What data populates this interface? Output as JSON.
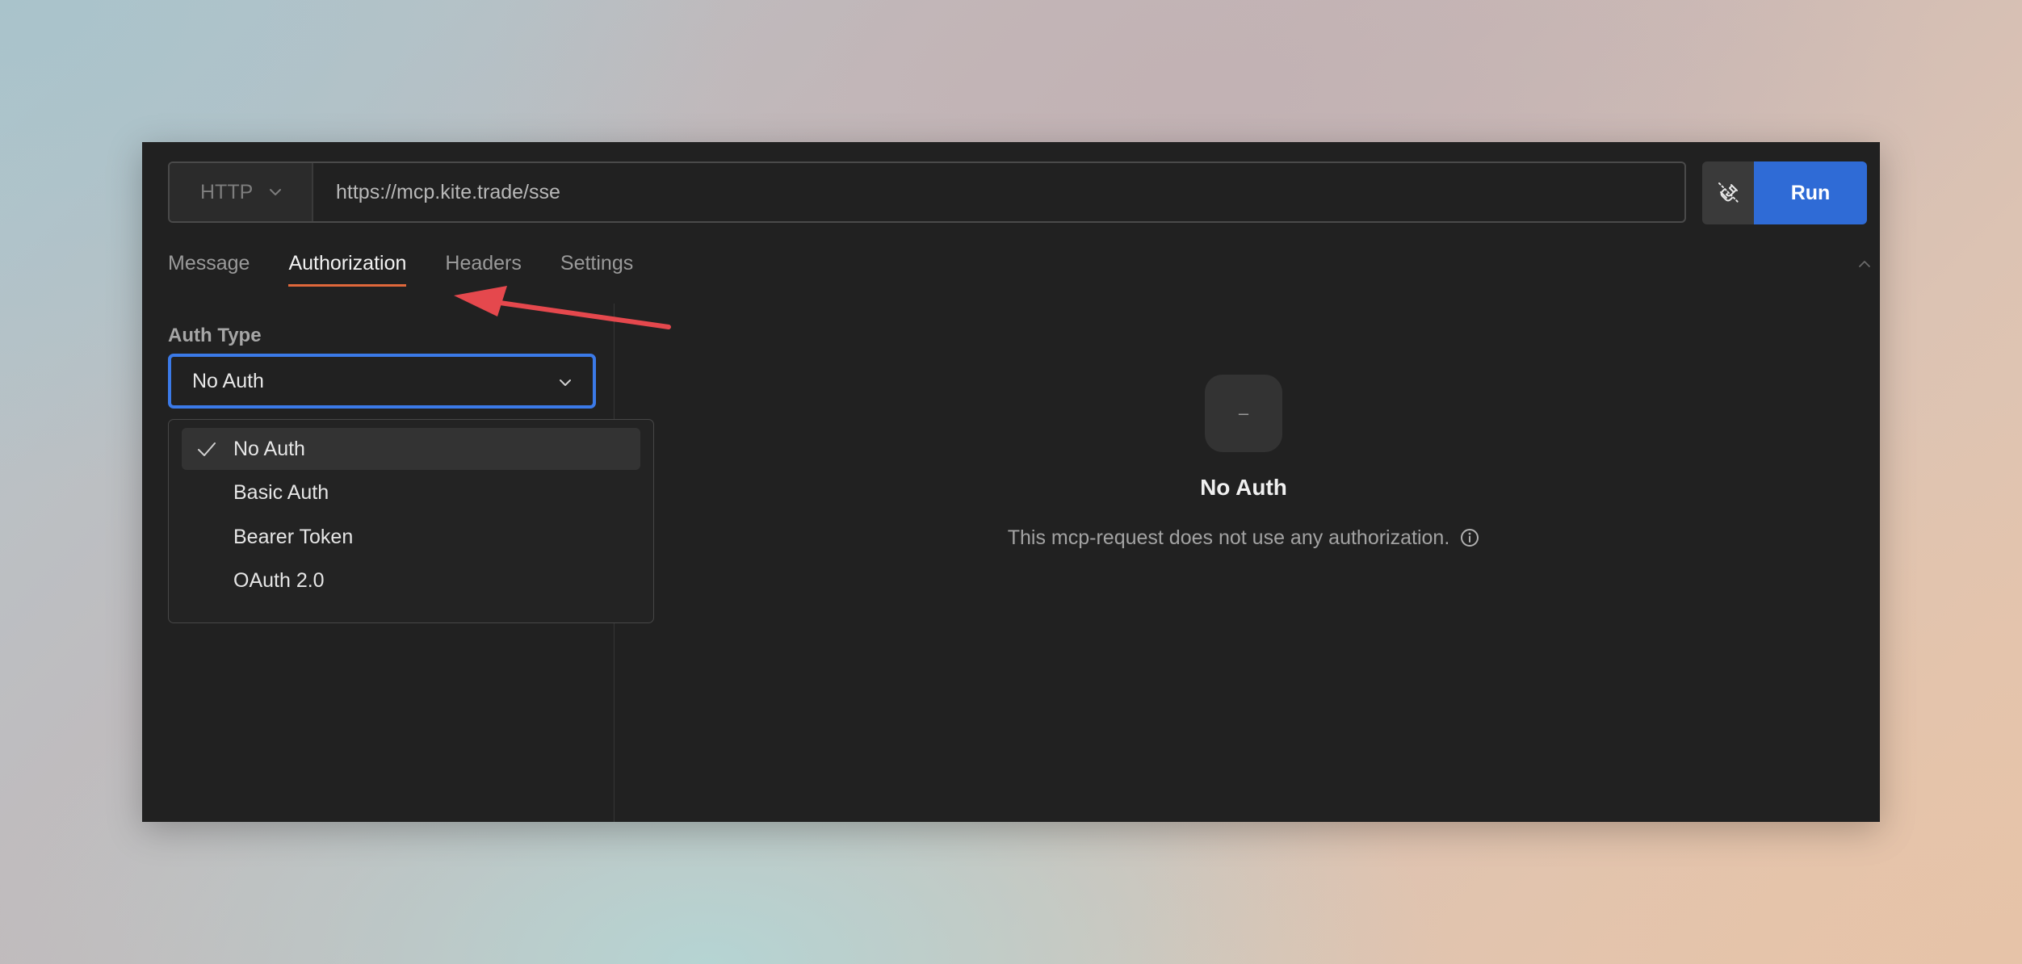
{
  "request": {
    "method": "HTTP",
    "url": "https://mcp.kite.trade/sse",
    "run_label": "Run"
  },
  "tabs": [
    {
      "label": "Message"
    },
    {
      "label": "Authorization"
    },
    {
      "label": "Headers"
    },
    {
      "label": "Settings"
    }
  ],
  "active_tab": "Authorization",
  "auth": {
    "label": "Auth Type",
    "selected": "No Auth",
    "options": [
      {
        "label": "No Auth",
        "selected": true
      },
      {
        "label": "Basic Auth",
        "selected": false
      },
      {
        "label": "Bearer Token",
        "selected": false
      },
      {
        "label": "OAuth 2.0",
        "selected": false
      }
    ]
  },
  "empty_state": {
    "icon_text": "–",
    "title": "No Auth",
    "description": "This mcp-request does not use any authorization."
  },
  "colors": {
    "accent": "#2f6bd6",
    "tab_underline": "#e0683b",
    "select_focus": "#3b7ae8",
    "annotation_arrow": "#e5484d",
    "panel_bg": "#212121"
  },
  "icons": {
    "method_chevron": "chevron-down-icon",
    "plug": "disconnect-plug-icon",
    "collapse": "chevron-up-icon",
    "check": "check-icon",
    "info": "info-icon"
  }
}
